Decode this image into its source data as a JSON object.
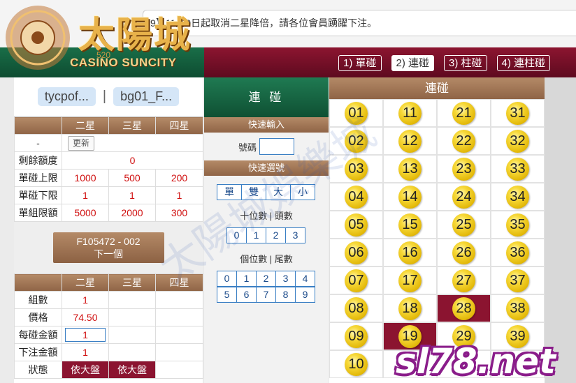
{
  "marquee": {
    "text": "9】11月9日起取消二星降倍，請各位會員踴躍下注。"
  },
  "logo": {
    "main": "太陽城",
    "sub": "CASINO SUNCITY",
    "num": "520"
  },
  "tabs": [
    {
      "label": "1) 單碰"
    },
    {
      "label": "2) 連碰"
    },
    {
      "label": "3) 柱碰"
    },
    {
      "label": "4) 連柱碰"
    }
  ],
  "users": {
    "user1": "tycpof...",
    "sep": "|",
    "user2": "bg01_F..."
  },
  "limits": {
    "headers": [
      "二星",
      "三星",
      "四星"
    ],
    "dash": "-",
    "refresh": "更新",
    "rows": [
      {
        "label": "剩餘額度",
        "value": "0"
      },
      {
        "label": "單碰上限",
        "values": [
          "1000",
          "500",
          "200"
        ]
      },
      {
        "label": "單碰下限",
        "values": [
          "1",
          "1",
          "1"
        ]
      },
      {
        "label": "單組限額",
        "values": [
          "5000",
          "2000",
          "300"
        ]
      }
    ]
  },
  "next": {
    "line1": "F105472 - 002",
    "line2": "下一個"
  },
  "bet": {
    "headers": [
      "二星",
      "三星",
      "四星"
    ],
    "group_label": "組數",
    "group_value": "1",
    "price_label": "價格",
    "price_value": "74.50",
    "each_label": "每碰金額",
    "each_value": "1",
    "total_label": "下注金額",
    "total_value": "1",
    "status_label": "狀態",
    "status1": "依大盤",
    "status2": "依大盤"
  },
  "mid": {
    "title": "連 碰",
    "quick_input": "快速輸入",
    "number_label": "號碼",
    "quick_select": "快速選號",
    "btns1": [
      "單",
      "雙",
      "大",
      "小"
    ],
    "tens_label": "十位數 | 頭數",
    "tens": [
      "0",
      "1",
      "2",
      "3"
    ],
    "units_label": "個位數 | 尾數",
    "units_row1": [
      "0",
      "1",
      "2",
      "3",
      "4"
    ],
    "units_row2": [
      "5",
      "6",
      "7",
      "8",
      "9"
    ]
  },
  "right": {
    "title": "連碰",
    "balls": [
      "01",
      "11",
      "21",
      "31",
      "02",
      "12",
      "22",
      "32",
      "03",
      "13",
      "23",
      "33",
      "04",
      "14",
      "24",
      "34",
      "05",
      "15",
      "25",
      "35",
      "06",
      "16",
      "26",
      "36",
      "07",
      "17",
      "27",
      "37",
      "08",
      "18",
      "28",
      "38",
      "09",
      "19",
      "29",
      "39",
      "10",
      "",
      "",
      ""
    ],
    "selected": [
      "28",
      "19"
    ]
  },
  "watermark": {
    "text": "sl78.net",
    "diag": "太陽城娛樂城"
  }
}
